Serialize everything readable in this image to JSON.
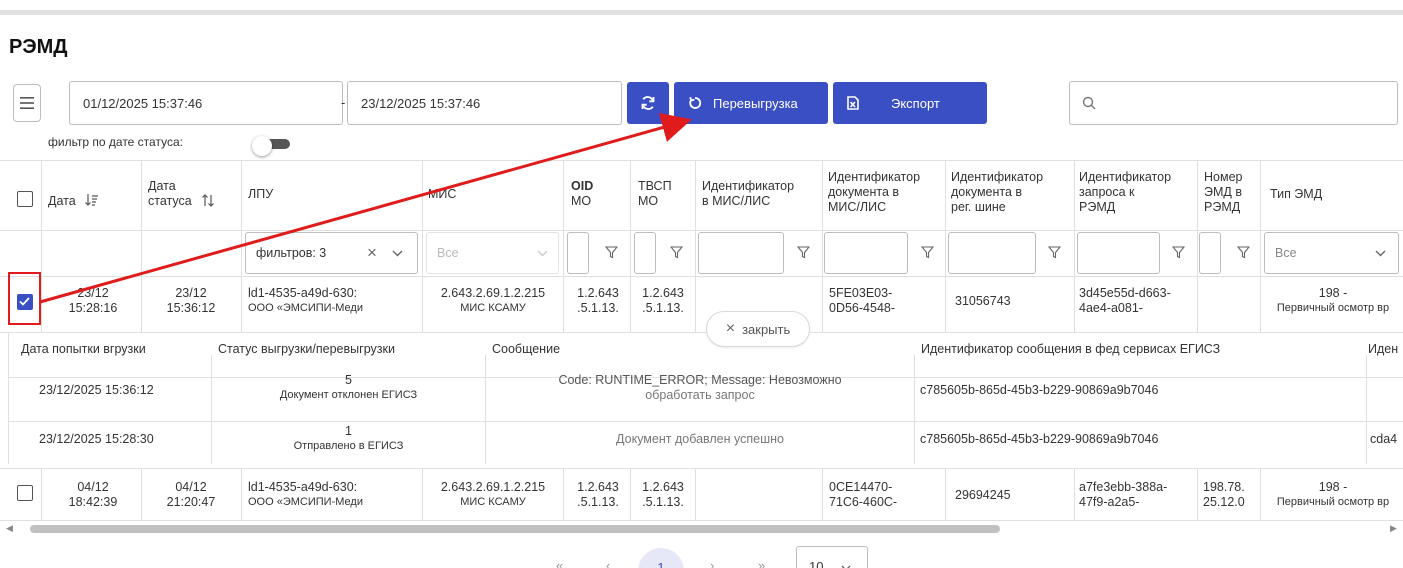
{
  "page": {
    "title": "РЭМД"
  },
  "toolbar": {
    "date_from": "01/12/2025 15:37:46",
    "date_separator": "-",
    "date_to": "23/12/2025 15:37:46",
    "reupload_label": "Перевыгрузка",
    "export_label": "Экспорт",
    "search_value": "",
    "status_date_filter_label": "фильтр по дате статуса:"
  },
  "columns": {
    "date": "Дата",
    "status_date_1": "Дата",
    "status_date_2": "статуса",
    "lpu": "ЛПУ",
    "mis": "МИС",
    "oid_mo_1": "OID",
    "oid_mo_2": "МО",
    "tvsp_mo_1": "ТВСП",
    "tvsp_mo_2": "МО",
    "mis_lis_id_1": "Идентификатор",
    "mis_lis_id_2": "в МИС/ЛИС",
    "doc_mis_id_1": "Идентификатор",
    "doc_mis_id_2": "документа в",
    "doc_mis_id_3": "МИС/ЛИС",
    "doc_bus_id_1": "Идентификатор",
    "doc_bus_id_2": "документа в",
    "doc_bus_id_3": "рег. шине",
    "req_id_1": "Идентификатор",
    "req_id_2": "запроса к",
    "req_id_3": "РЭМД",
    "emd_num_1": "Номер",
    "emd_num_2": "ЭМД в",
    "emd_num_3": "РЭМД",
    "emd_type": "Тип ЭМД"
  },
  "filters": {
    "lpu": "фильтров: 3",
    "mis": "Все",
    "emd_type": "Все"
  },
  "rows": [
    {
      "date_1": "23/12",
      "date_2": "15:28:16",
      "status_date_1": "23/12",
      "status_date_2": "15:36:12",
      "lpu_1": "ld1-4535-a49d-630:",
      "lpu_2": "ООО «ЭМСИПИ-Меди",
      "mis_1": "2.643.2.69.1.2.215",
      "mis_2": "МИС КСАМУ",
      "oid_1": "1.2.643",
      "oid_2": ".5.1.13.",
      "tvsp_1": "1.2.643",
      "tvsp_2": ".5.1.13.",
      "doc_mis_1": "5FE03E03-",
      "doc_mis_2": "0D56-4548-",
      "doc_bus": "31056743",
      "req_1": "3d45e55d-d663-",
      "req_2": "4ae4-a081-",
      "emd_num_1": "",
      "emd_num_2": "",
      "type_1": "198 -",
      "type_2": "Первичный осмотр вр"
    },
    {
      "date_1": "04/12",
      "date_2": "18:42:39",
      "status_date_1": "04/12",
      "status_date_2": "21:20:47",
      "lpu_1": "ld1-4535-a49d-630:",
      "lpu_2": "ООО «ЭМСИПИ-Меди",
      "mis_1": "2.643.2.69.1.2.215",
      "mis_2": "МИС КСАМУ",
      "oid_1": "1.2.643",
      "oid_2": ".5.1.13.",
      "tvsp_1": "1.2.643",
      "tvsp_2": ".5.1.13.",
      "doc_mis_1": "0CE14470-",
      "doc_mis_2": "71C6-460C-",
      "doc_bus": "29694245",
      "req_1": "a7fe3ebb-388a-",
      "req_2": "47f9-a2a5-",
      "emd_num_1": "198.78.",
      "emd_num_2": "25.12.0",
      "type_1": "198 -",
      "type_2": "Первичный осмотр вр"
    }
  ],
  "details": {
    "close_label": "закрыть",
    "headers": {
      "attempt_date": "Дата попытки вгрузки",
      "status": "Статус выгрузки/перевыгрузки",
      "message": "Сообщение",
      "fed_id": "Идентификатор сообщения в фед сервисах ЕГИСЗ",
      "extra": "Иден"
    },
    "items": [
      {
        "attempt_date": "23/12/2025 15:36:12",
        "status_code": "5",
        "status_text": "Документ отклонен ЕГИСЗ",
        "message_1": "Code: RUNTIME_ERROR; Message: Невозможно",
        "message_2": "обработать запрос",
        "fed_id": "c785605b-865d-45b3-b229-90869a9b7046",
        "extra": ""
      },
      {
        "attempt_date": "23/12/2025 15:28:30",
        "status_code": "1",
        "status_text": "Отправлено в ЕГИСЗ",
        "message_1": "Документ добавлен успешно",
        "message_2": "",
        "fed_id": "c785605b-865d-45b3-b229-90869a9b7046",
        "extra": "cda4"
      }
    ]
  },
  "pagination": {
    "first": "«",
    "prev": "‹",
    "current": "1",
    "next": "›",
    "last": "»",
    "page_size": "10"
  },
  "colors": {
    "accent": "#3b4fc4",
    "annotation": "#e01b1b"
  }
}
